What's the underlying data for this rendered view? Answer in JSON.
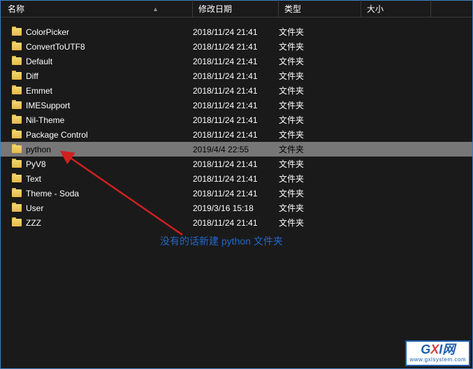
{
  "columns": {
    "name": "名称",
    "date": "修改日期",
    "type": "类型",
    "size": "大小"
  },
  "rows": [
    {
      "name": "ColorPicker",
      "date": "2018/11/24 21:41",
      "type": "文件夹",
      "selected": false
    },
    {
      "name": "ConvertToUTF8",
      "date": "2018/11/24 21:41",
      "type": "文件夹",
      "selected": false
    },
    {
      "name": "Default",
      "date": "2018/11/24 21:41",
      "type": "文件夹",
      "selected": false
    },
    {
      "name": "Diff",
      "date": "2018/11/24 21:41",
      "type": "文件夹",
      "selected": false
    },
    {
      "name": "Emmet",
      "date": "2018/11/24 21:41",
      "type": "文件夹",
      "selected": false
    },
    {
      "name": "IMESupport",
      "date": "2018/11/24 21:41",
      "type": "文件夹",
      "selected": false
    },
    {
      "name": "Nil-Theme",
      "date": "2018/11/24 21:41",
      "type": "文件夹",
      "selected": false
    },
    {
      "name": "Package Control",
      "date": "2018/11/24 21:41",
      "type": "文件夹",
      "selected": false
    },
    {
      "name": "python",
      "date": "2019/4/4 22:55",
      "type": "文件夹",
      "selected": true
    },
    {
      "name": "PyV8",
      "date": "2018/11/24 21:41",
      "type": "文件夹",
      "selected": false
    },
    {
      "name": "Text",
      "date": "2018/11/24 21:41",
      "type": "文件夹",
      "selected": false
    },
    {
      "name": "Theme - Soda",
      "date": "2018/11/24 21:41",
      "type": "文件夹",
      "selected": false
    },
    {
      "name": "User",
      "date": "2019/3/16 15:18",
      "type": "文件夹",
      "selected": false
    },
    {
      "name": "ZZZ",
      "date": "2018/11/24 21:41",
      "type": "文件夹",
      "selected": false
    }
  ],
  "annotation": "没有的话新建 python 文件夹",
  "watermark": {
    "brand_g": "G",
    "brand_x": "X",
    "brand_i": "I",
    "brand_net": "网",
    "url": "www.gxlsystem.com"
  }
}
